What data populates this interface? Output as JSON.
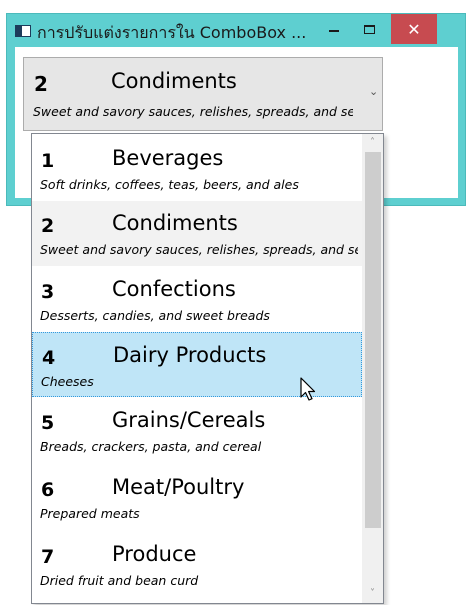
{
  "window": {
    "title": "การปรับแต่งรายการใน ComboBox ...",
    "minimize_glyph": "–",
    "maximize_glyph": "□",
    "close_glyph": "✕"
  },
  "combo": {
    "selected": {
      "id": "2",
      "name": "Condiments",
      "description": "Sweet and savory sauces, relishes, spreads, and seasonings"
    },
    "chevron": "⌄"
  },
  "list": {
    "items": [
      {
        "id": "1",
        "name": "Beverages",
        "description": "Soft drinks, coffees, teas, beers, and ales"
      },
      {
        "id": "2",
        "name": "Condiments",
        "description": "Sweet and savory sauces, relishes, spreads, and seasonings"
      },
      {
        "id": "3",
        "name": "Confections",
        "description": "Desserts, candies, and sweet breads"
      },
      {
        "id": "4",
        "name": "Dairy Products",
        "description": "Cheeses"
      },
      {
        "id": "5",
        "name": "Grains/Cereals",
        "description": "Breads, crackers, pasta, and cereal"
      },
      {
        "id": "6",
        "name": "Meat/Poultry",
        "description": "Prepared meats"
      },
      {
        "id": "7",
        "name": "Produce",
        "description": "Dried fruit and bean curd"
      }
    ],
    "selected_index": 1,
    "hover_index": 3
  },
  "scrollbar": {
    "up_glyph": "˄",
    "down_glyph": "˅"
  },
  "colors": {
    "titlebar": "#5ecfd0",
    "close_button": "#c74b50",
    "hover_item": "#bfe5f7",
    "selected_item": "#f2f2f2"
  }
}
